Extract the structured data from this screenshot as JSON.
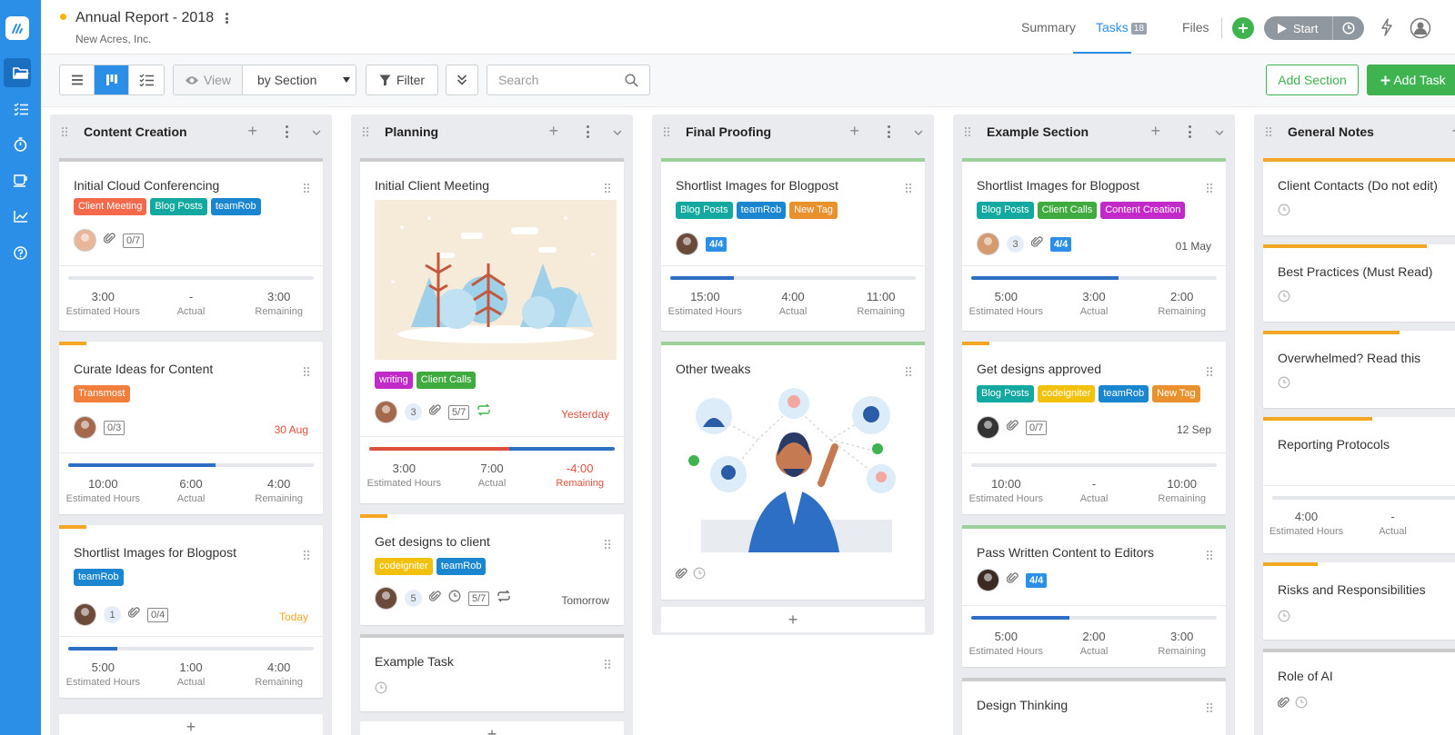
{
  "header": {
    "title": "Annual Report - 2018",
    "company": "New Acres, Inc.",
    "tabs": [
      {
        "label": "Summary"
      },
      {
        "label": "Tasks",
        "count": "18"
      },
      {
        "label": "Files"
      }
    ],
    "start_label": "Start"
  },
  "toolbar": {
    "view_label": "View",
    "group_by": "by Section",
    "filter_label": "Filter",
    "search_placeholder": "Search",
    "add_section_label": "Add Section",
    "add_task_label": "Add Task"
  },
  "hour_labels": {
    "estimated": "Estimated Hours",
    "actual": "Actual",
    "remaining": "Remaining"
  },
  "colors": {
    "brand": "#2b8fe8",
    "green": "#3fb34f",
    "progress": "#2d6fc4",
    "overdue": "#e0503e",
    "today": "#f5a623"
  },
  "tag_colors": {
    "Client Meeting": "#f26a4b",
    "Blog Posts": "#13a8a0",
    "teamRob": "#1a86d0",
    "Transmost": "#f07f3c",
    "writing": "#c229c9",
    "Client Calls": "#3fab3f",
    "codeigniter": "#f2c10b",
    "New Tag": "#e8912d",
    "Content Creation": "#c229c9"
  },
  "columns": [
    {
      "title": "Content Creation",
      "cards": [
        {
          "title": "Initial Cloud Conferencing",
          "tags": [
            "Client Meeting",
            "Blog Posts",
            "teamRob"
          ],
          "checklist": "0/7",
          "est": "3:00",
          "actual": "-",
          "remaining": "3:00",
          "progress": 0
        },
        {
          "title": "Curate Ideas for Content",
          "tags": [
            "Transmost"
          ],
          "checklist": "0/3",
          "due": "30 Aug",
          "est": "10:00",
          "actual": "6:00",
          "remaining": "4:00",
          "progress": 0.6
        },
        {
          "title": "Shortlist Images for Blogpost",
          "tags": [
            "teamRob"
          ],
          "comments": "1",
          "checklist": "0/4",
          "due": "Today",
          "est": "5:00",
          "actual": "1:00",
          "remaining": "4:00",
          "progress": 0.2
        }
      ]
    },
    {
      "title": "Planning",
      "cards": [
        {
          "title": "Initial Client Meeting",
          "tags": [
            "writing",
            "Client Calls"
          ],
          "comments": "3",
          "checklist": "5/7",
          "due": "Yesterday",
          "est": "3:00",
          "actual": "7:00",
          "remaining": "-4:00"
        },
        {
          "title": "Get designs to client",
          "tags": [
            "codeigniter",
            "teamRob"
          ],
          "comments": "5",
          "checklist": "5/7",
          "due": "Tomorrow"
        },
        {
          "title": "Example Task"
        }
      ]
    },
    {
      "title": "Final Proofing",
      "cards": [
        {
          "title": "Shortlist Images for Blogpost",
          "tags": [
            "Blog Posts",
            "teamRob",
            "New Tag"
          ],
          "checklist": "4/4",
          "est": "15:00",
          "actual": "4:00",
          "remaining": "11:00",
          "progress": 0.26
        },
        {
          "title": "Other tweaks"
        }
      ]
    },
    {
      "title": "Example Section",
      "cards": [
        {
          "title": "Shortlist Images for Blogpost",
          "tags": [
            "Blog Posts",
            "Client Calls",
            "Content Creation"
          ],
          "comments": "3",
          "checklist": "4/4",
          "due": "01 May",
          "est": "5:00",
          "actual": "3:00",
          "remaining": "2:00",
          "progress": 0.6
        },
        {
          "title": "Get designs approved",
          "tags": [
            "Blog Posts",
            "codeigniter",
            "teamRob",
            "New Tag"
          ],
          "checklist": "0/7",
          "due": "12 Sep",
          "est": "10:00",
          "actual": "-",
          "remaining": "10:00",
          "progress": 0
        },
        {
          "title": "Pass Written Content to Editors",
          "checklist": "4/4",
          "est": "5:00",
          "actual": "2:00",
          "remaining": "3:00",
          "progress": 0.4
        },
        {
          "title": "Design Thinking"
        }
      ]
    },
    {
      "title": "General Notes",
      "cards": [
        {
          "title": "Client Contacts (Do not edit)"
        },
        {
          "title": "Best Practices (Must Read)"
        },
        {
          "title": "Overwhelmed? Read this"
        },
        {
          "title": "Reporting Protocols",
          "est": "4:00",
          "actual": "-"
        },
        {
          "title": "Risks and Responsibilities"
        },
        {
          "title": "Role of AI"
        }
      ]
    }
  ]
}
